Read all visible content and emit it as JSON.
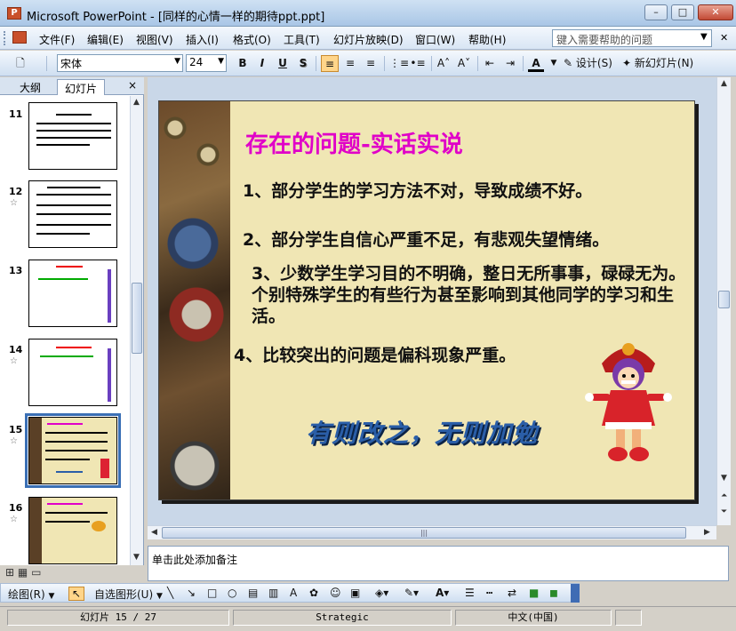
{
  "window": {
    "app_icon": "powerpoint-icon",
    "title": "Microsoft PowerPoint - [同样的心情一样的期待ppt.ppt]",
    "controls": {
      "minimize": "–",
      "maximize": "□",
      "close": "✕"
    }
  },
  "menu": {
    "items": [
      "文件(F)",
      "编辑(E)",
      "视图(V)",
      "插入(I)",
      "格式(O)",
      "工具(T)",
      "幻灯片放映(D)",
      "窗口(W)",
      "帮助(H)"
    ],
    "help_placeholder": "键入需要帮助的问题"
  },
  "toolbar": {
    "font_name": "宋体",
    "font_size": "24",
    "bold": "B",
    "italic": "I",
    "underline": "U",
    "shadow": "S",
    "font_color": "A",
    "design": "设计(S)",
    "new_slide": "新幻灯片(N)"
  },
  "left_pane": {
    "tabs": [
      "大纲",
      "幻灯片"
    ],
    "active_tab": "幻灯片",
    "close": "×",
    "slides": [
      "11",
      "12",
      "13",
      "14",
      "15",
      "16"
    ],
    "selected_slide": "15"
  },
  "slide": {
    "title": "存在的问题-实话实说",
    "points": [
      "1、部分学生的学习方法不对，导致成绩不好。",
      "2、部分学生自信心严重不足，有悲观失望情绪。",
      "3、少数学生学习目的不明确，整日无所事事，碌碌无为。个别特殊学生的有些行为甚至影响到其他同学的学习和生活。",
      "4、比较突出的问题是偏科现象严重。"
    ],
    "banner": "有则改之，无则加勉",
    "title_color": "#e000c8",
    "banner_color": "#2a5ea8",
    "background_color": "#f0e6b4"
  },
  "notes": {
    "placeholder": "单击此处添加备注"
  },
  "drawing_toolbar": {
    "draw": "绘图(R)",
    "autoshapes": "自选图形(U)"
  },
  "status": {
    "slide_position": "幻灯片 15 / 27",
    "design_template": "Strategic",
    "language": "中文(中国)"
  }
}
